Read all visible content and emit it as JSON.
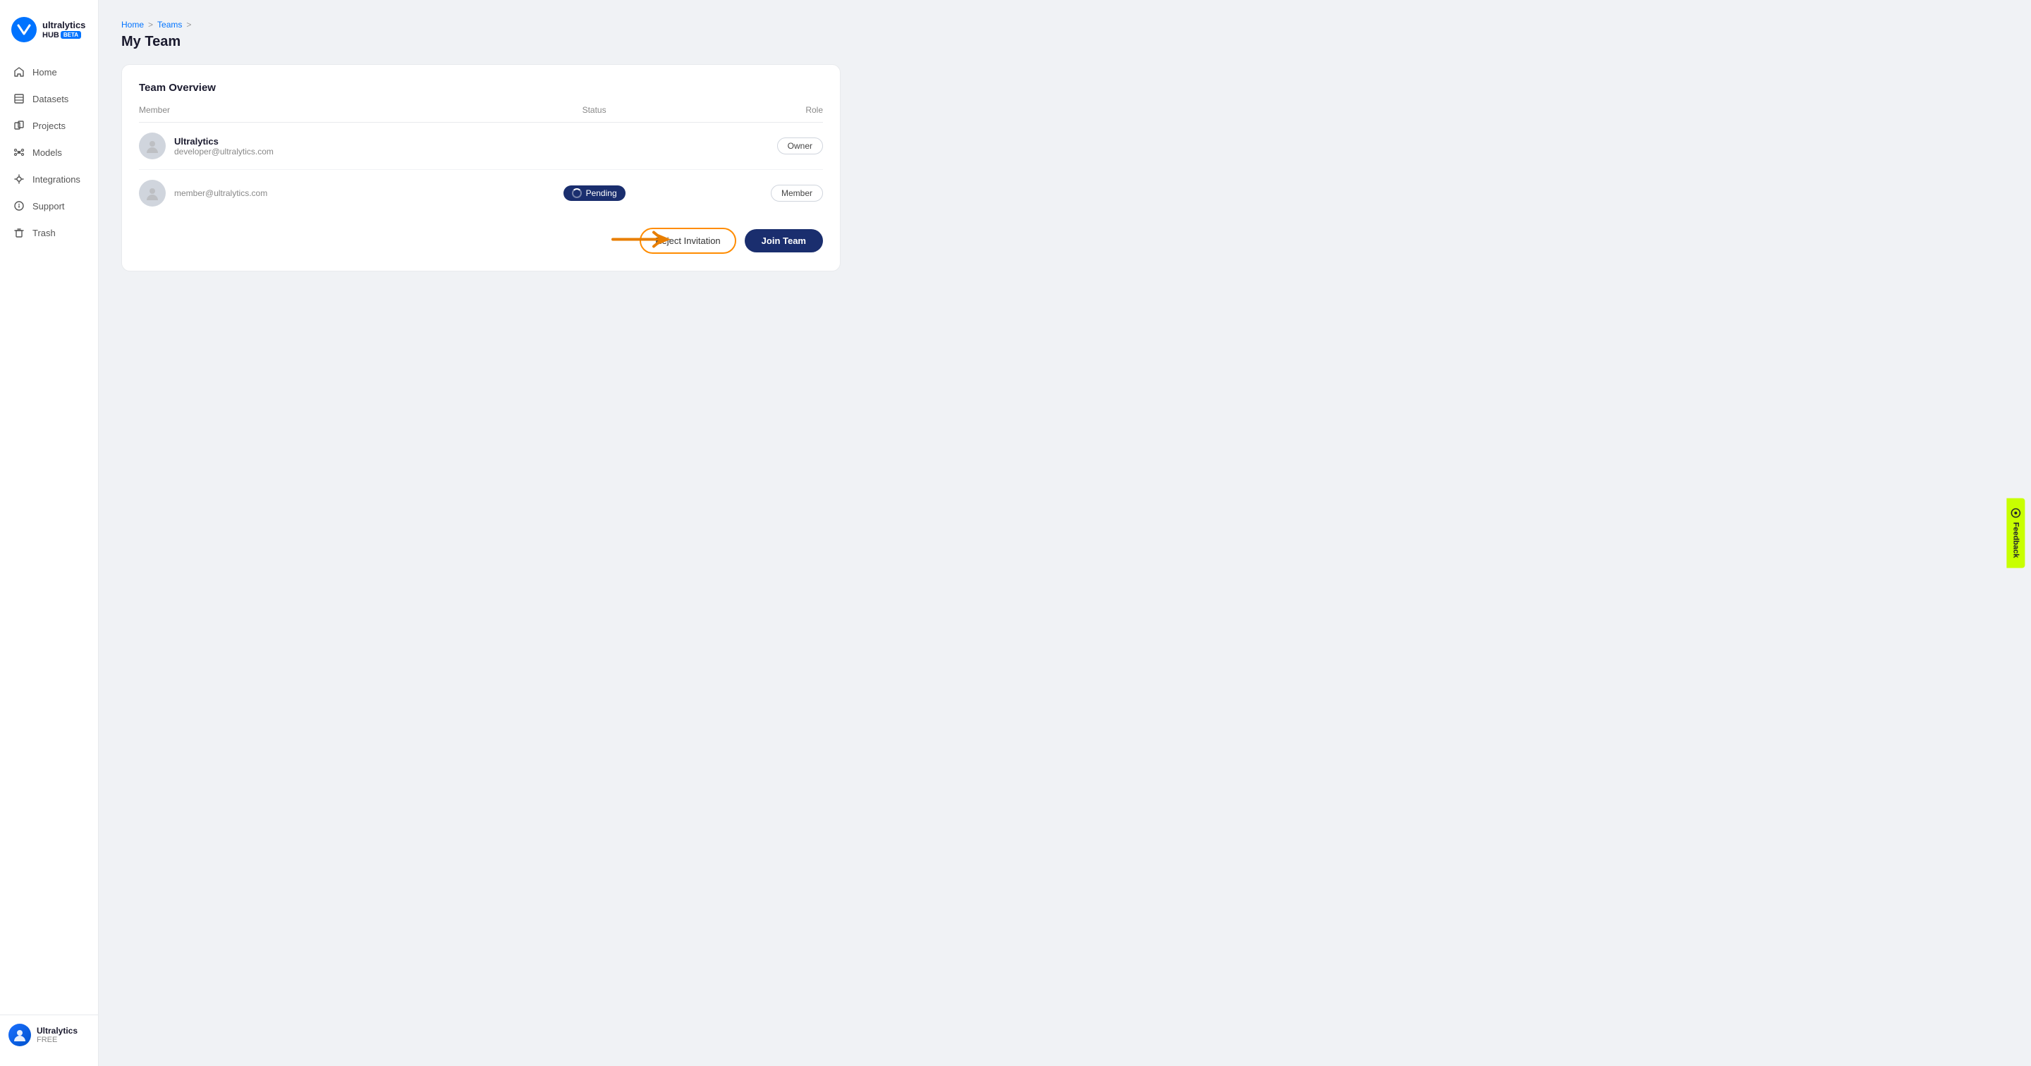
{
  "app": {
    "name": "ultralytics",
    "hub": "HUB",
    "beta": "BETA",
    "plan": "FREE"
  },
  "sidebar": {
    "items": [
      {
        "id": "home",
        "label": "Home",
        "icon": "home"
      },
      {
        "id": "datasets",
        "label": "Datasets",
        "icon": "datasets"
      },
      {
        "id": "projects",
        "label": "Projects",
        "icon": "projects"
      },
      {
        "id": "models",
        "label": "Models",
        "icon": "models"
      },
      {
        "id": "integrations",
        "label": "Integrations",
        "icon": "integrations"
      },
      {
        "id": "support",
        "label": "Support",
        "icon": "support"
      },
      {
        "id": "trash",
        "label": "Trash",
        "icon": "trash"
      }
    ]
  },
  "user": {
    "name": "Ultralytics",
    "plan": "FREE"
  },
  "breadcrumb": {
    "items": [
      "Home",
      "Teams"
    ]
  },
  "page": {
    "title": "My Team"
  },
  "card": {
    "title": "Team Overview",
    "columns": {
      "member": "Member",
      "status": "Status",
      "role": "Role"
    },
    "members": [
      {
        "name": "Ultralytics",
        "email": "developer@ultralytics.com",
        "status": "",
        "role": "Owner"
      },
      {
        "name": "",
        "email": "member@ultralytics.com",
        "status": "Pending",
        "role": "Member"
      }
    ],
    "actions": {
      "reject": "Reject Invitation",
      "join": "Join Team"
    }
  },
  "feedback": {
    "label": "Feedback"
  }
}
